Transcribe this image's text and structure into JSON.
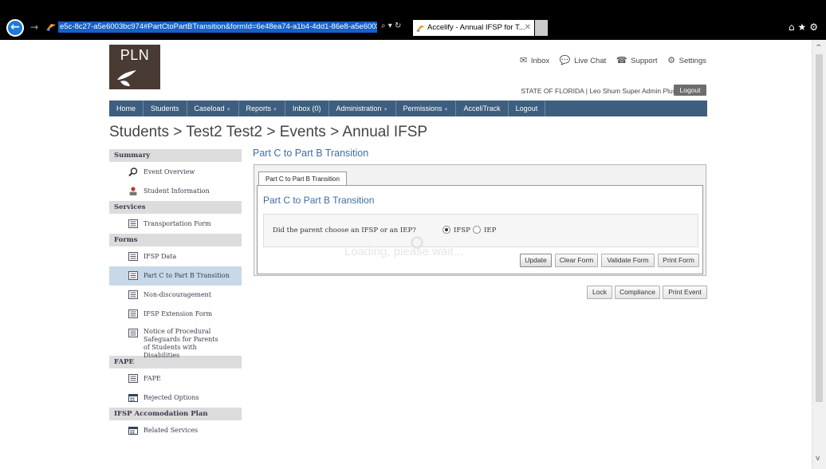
{
  "browser": {
    "url": "e5c-8c27-a5e6003bc974#PartCtoPartBTransition&formId=6e48ea74-a1b4-4dd1-86e8-a5e6003bc990",
    "tab_title": "Accelify - Annual IFSP for T...",
    "address_actions": "⌕ ▾ ↻"
  },
  "header": {
    "logo_text": "PLN",
    "links": [
      {
        "icon": "✉",
        "label": "Inbox"
      },
      {
        "icon": "💬",
        "label": "Live Chat"
      },
      {
        "icon": "☎",
        "label": "Support"
      },
      {
        "icon": "⚙",
        "label": "Settings"
      }
    ],
    "state_line": "STATE OF FLORIDA  |  Leo Shum Super Admin Plus",
    "logout_label": "Logout"
  },
  "nav": {
    "items": [
      {
        "label": "Home",
        "dropdown": false
      },
      {
        "label": "Students",
        "dropdown": false
      },
      {
        "label": "Caseload",
        "dropdown": true
      },
      {
        "label": "Reports",
        "dropdown": true
      },
      {
        "label": "Inbox (0)",
        "dropdown": false
      },
      {
        "label": "Administration",
        "dropdown": true
      },
      {
        "label": "Permissions",
        "dropdown": true
      },
      {
        "label": "AcceliTrack",
        "dropdown": false
      },
      {
        "label": "Logout",
        "dropdown": false
      }
    ]
  },
  "breadcrumb": "Students > Test2 Test2 > Events > Annual IFSP",
  "sidebar": {
    "summary": "Summary",
    "event_overview": "Event Overview",
    "student_information": "Student Information",
    "services": "Services",
    "transportation_form": "Transportation Form",
    "forms": "Forms",
    "ifsp_data": "IFSP Data",
    "part_c_to_part_b": "Part C to Part B Transition",
    "non_discouragement": "Non-discouragement",
    "ifsp_extension": "IFSP Extension Form",
    "notice_procedural": "Notice of Procedural Safeguards for Parents of Students with Disabilities",
    "fape_header": "FAPE",
    "fape": "FAPE",
    "rejected_options": "Rejected Options",
    "accomodation_plan": "IFSP Accomodation Plan",
    "related_services": "Related Services"
  },
  "main": {
    "section_title": "Part C to Part B Transition",
    "tab_label": "Part C to Part B Transition",
    "form_title": "Part C to Part B Transition",
    "question": "Did the parent choose an IFSP or an IEP?",
    "option_ifsp": "IFSP",
    "option_iep": "IEP",
    "selected_option": "IFSP",
    "loading_text": "Loading, please wait...",
    "buttons": {
      "update": "Update",
      "clear_form": "Clear Form",
      "validate_form": "Validate Form",
      "print_form": "Print Form",
      "lock": "Lock",
      "compliance": "Compliance",
      "print_event": "Print Event"
    }
  },
  "colors": {
    "nav_bg": "#3e5e7e",
    "title_blue": "#3e6da3",
    "logo_bg": "#4a3a34",
    "selected_item": "#c7d9e8"
  }
}
